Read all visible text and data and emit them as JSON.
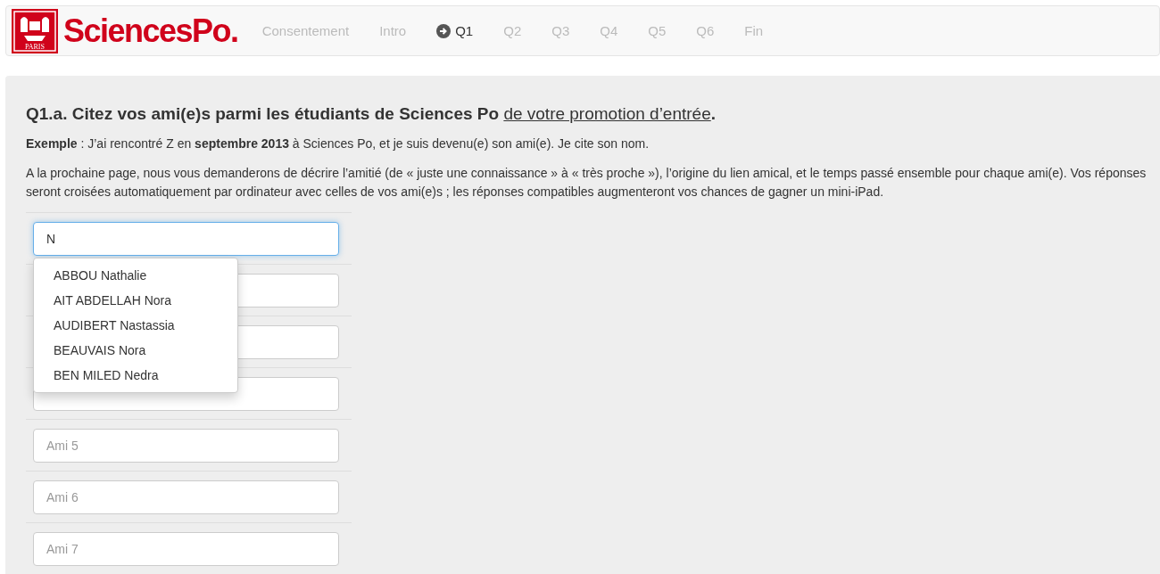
{
  "brand": {
    "name": "SciencesPo.",
    "emblem_caption": "PARIS"
  },
  "nav": [
    {
      "label": "Consentement",
      "selected": false,
      "current": false
    },
    {
      "label": "Intro",
      "selected": false,
      "current": false
    },
    {
      "label": "Q1",
      "selected": true,
      "current": true
    },
    {
      "label": "Q2",
      "selected": false,
      "current": false
    },
    {
      "label": "Q3",
      "selected": false,
      "current": false
    },
    {
      "label": "Q4",
      "selected": false,
      "current": false
    },
    {
      "label": "Q5",
      "selected": false,
      "current": false
    },
    {
      "label": "Q6",
      "selected": false,
      "current": false
    },
    {
      "label": "Fin",
      "selected": false,
      "current": false
    }
  ],
  "question": {
    "heading": "Q1.a. Citez vos ami(e)s parmi les étudiants de Sciences Po",
    "heading_underlined": "de votre promotion d’entrée",
    "heading_end": ".",
    "example": "**Exemple** : J’ai rencontré Z en **septembre 2013** à Sciences Po, et je suis devenu(e) son ami(e). Je cite son nom.",
    "explanation": "A la prochaine page, nous vous demanderons de décrire l’amitié (de « juste une connaissance » à « très proche »), l’origine du lien amical, et le temps passé ensemble pour chaque ami(e). Vos réponses seront croisées automatiquement par ordinateur avec celles de vos ami(e)s ; les réponses compatibles augmenteront vos chances de gagner un mini-iPad."
  },
  "friends": [
    {
      "value": "N",
      "focused": true
    },
    {
      "focused": false
    },
    {
      "focused": false
    },
    {
      "focused": false
    },
    {
      "placeholder": "Ami 5",
      "focused": false
    },
    {
      "placeholder": "Ami 6",
      "focused": false
    },
    {
      "placeholder": "Ami 7",
      "focused": false
    }
  ],
  "suggestions": [
    "ABBOU Nathalie",
    "AIT ABDELLAH Nora",
    "AUDIBERT Nastassia",
    "BEAUVAIS Nora",
    "BEN MILED Nedra"
  ]
}
